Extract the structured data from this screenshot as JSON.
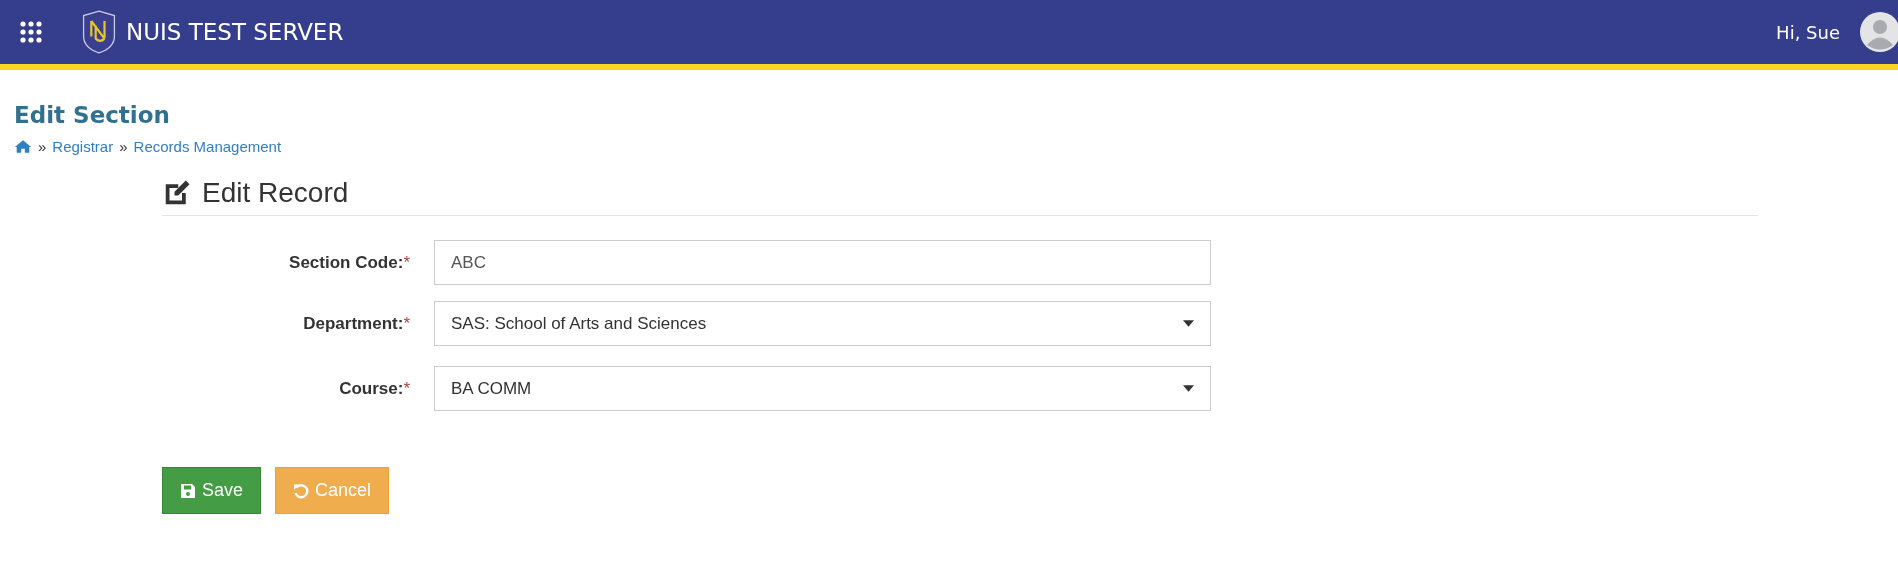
{
  "header": {
    "title": "NUIS TEST SERVER",
    "greeting": "Hi, Sue"
  },
  "page_title": "Edit Section",
  "breadcrumb": [
    "»",
    "Registrar",
    "»",
    "Records Management"
  ],
  "form": {
    "title": "Edit Record",
    "fields": [
      {
        "label": "Section Code:",
        "required_mark": "*",
        "kind": "text",
        "value": "ABC"
      },
      {
        "label": "Department:",
        "required_mark": "*",
        "kind": "select",
        "value": "SAS: School of Arts and Sciences"
      },
      {
        "label": "Course:",
        "required_mark": "*",
        "kind": "select",
        "value": "BA COMM"
      }
    ],
    "buttons": [
      {
        "label": "Save",
        "kind": "save"
      },
      {
        "label": "Cancel",
        "kind": "cancel"
      }
    ]
  }
}
